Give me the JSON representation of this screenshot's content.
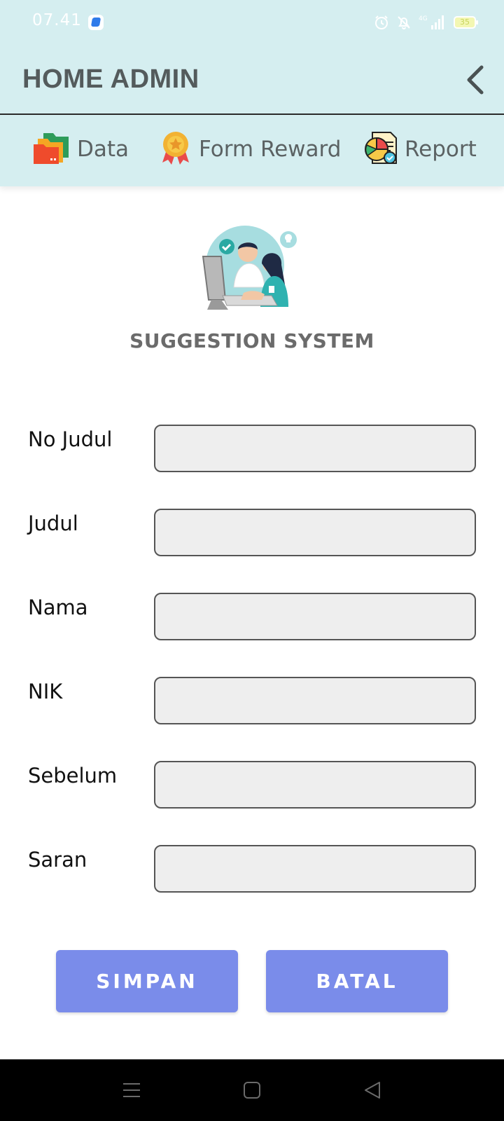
{
  "status_bar": {
    "time": "07.41",
    "network": "4G",
    "battery": "35"
  },
  "header": {
    "title": "HOME ADMIN"
  },
  "menu": {
    "items": [
      {
        "label": "Data",
        "icon": "folder-icon"
      },
      {
        "label": "Form Reward",
        "icon": "medal-icon"
      },
      {
        "label": "Report",
        "icon": "report-chart-icon"
      }
    ]
  },
  "page": {
    "title": "SUGGESTION SYSTEM"
  },
  "form": {
    "fields": [
      {
        "label": "No Judul",
        "value": "",
        "placeholder": ""
      },
      {
        "label": "Judul",
        "value": "",
        "placeholder": ""
      },
      {
        "label": "Nama",
        "value": "",
        "placeholder": ""
      },
      {
        "label": "NIK",
        "value": "",
        "placeholder": ""
      },
      {
        "label": "Sebelum",
        "value": "",
        "placeholder": ""
      },
      {
        "label": "Saran",
        "value": "",
        "placeholder": ""
      }
    ],
    "save_label": "SIMPAN",
    "cancel_label": "BATAL"
  },
  "colors": {
    "header_bg": "#d5eef0",
    "button_bg": "#7a8cea",
    "input_bg": "#eeeeee"
  }
}
